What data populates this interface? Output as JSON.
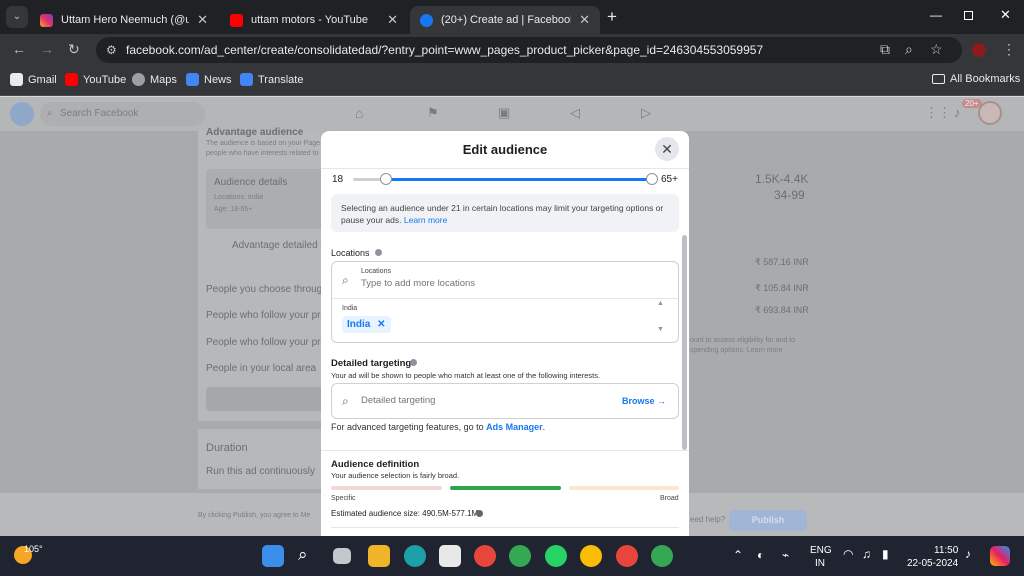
{
  "browser": {
    "tabs": [
      {
        "title": "Uttam Hero Neemuch (@uttam",
        "active": false,
        "favicon": "instagram-icon"
      },
      {
        "title": "uttam motors - YouTube",
        "active": false,
        "favicon": "youtube-icon"
      },
      {
        "title": "(20+) Create ad | Facebook",
        "active": true,
        "favicon": "facebook-icon"
      }
    ],
    "url": "facebook.com/ad_center/create/consolidatedad/?entry_point=www_pages_product_picker&page_id=246304553059957",
    "bookmarks": [
      "Gmail",
      "YouTube",
      "Maps",
      "News",
      "Translate"
    ],
    "all_bookmarks": "All Bookmarks"
  },
  "facebook": {
    "search_placeholder": "Search Facebook",
    "notif_badge": "20+",
    "background": {
      "advantage_audience": "Advantage audience",
      "adv_desc1": "The audience is based on your Page",
      "adv_desc2": "people who have interests related to",
      "audience_details": "Audience details",
      "locations_line": "Locations: India",
      "age_line": "Age: 18-65+",
      "advantage_detailed": "Advantage detailed ta",
      "people_choose": "People you choose through",
      "people_follow1": "People who follow your prof",
      "people_follow2": "People who follow your prof",
      "people_local": "People in your local area",
      "duration": "Duration",
      "run_continuously": "Run this ad continuously",
      "reach": "1.5K-4.4K",
      "reach2": "34-99",
      "price1": "₹ 587.16 INR",
      "price2": "₹ 105.84 INR",
      "price3": "₹ 693.84 INR",
      "note1": "ount to assess eligibility for and to",
      "note2": "spending options. Learn more",
      "footer_text": "By clicking Publish, you agree to Me",
      "need_help": "eed help?",
      "publish": "Publish"
    }
  },
  "modal": {
    "title": "Edit audience",
    "age_min": "18",
    "age_max": "65+",
    "age_min_value": 18,
    "age_max_value": 65,
    "notice": "Selecting an audience under 21 in certain locations may limit your targeting options or pause your ads.",
    "learn_more": "Learn more",
    "locations_label": "Locations",
    "locations_field_label": "Locations",
    "locations_placeholder": "Type to add more locations",
    "selected_group": "India",
    "selected_chip": "India",
    "detailed_title": "Detailed targeting",
    "detailed_desc": "Your ad will be shown to people who match at least one of the following interests.",
    "detailed_placeholder": "Detailed targeting",
    "browse": "Browse",
    "advanced_text": "For advanced targeting features, go to",
    "ads_manager": "Ads Manager",
    "definition_title": "Audience definition",
    "definition_desc": "Your audience selection is fairly broad.",
    "specific": "Specific",
    "broad": "Broad",
    "estimated": "Estimated audience size: 490.5M-577.1M",
    "audience_level": 0.5
  },
  "taskbar": {
    "weather": "105°",
    "lang1": "ENG",
    "lang2": "IN",
    "time": "11:50",
    "date": "22-05-2024"
  },
  "colors": {
    "accent": "#1877f2",
    "definition_green": "#31a24c"
  }
}
